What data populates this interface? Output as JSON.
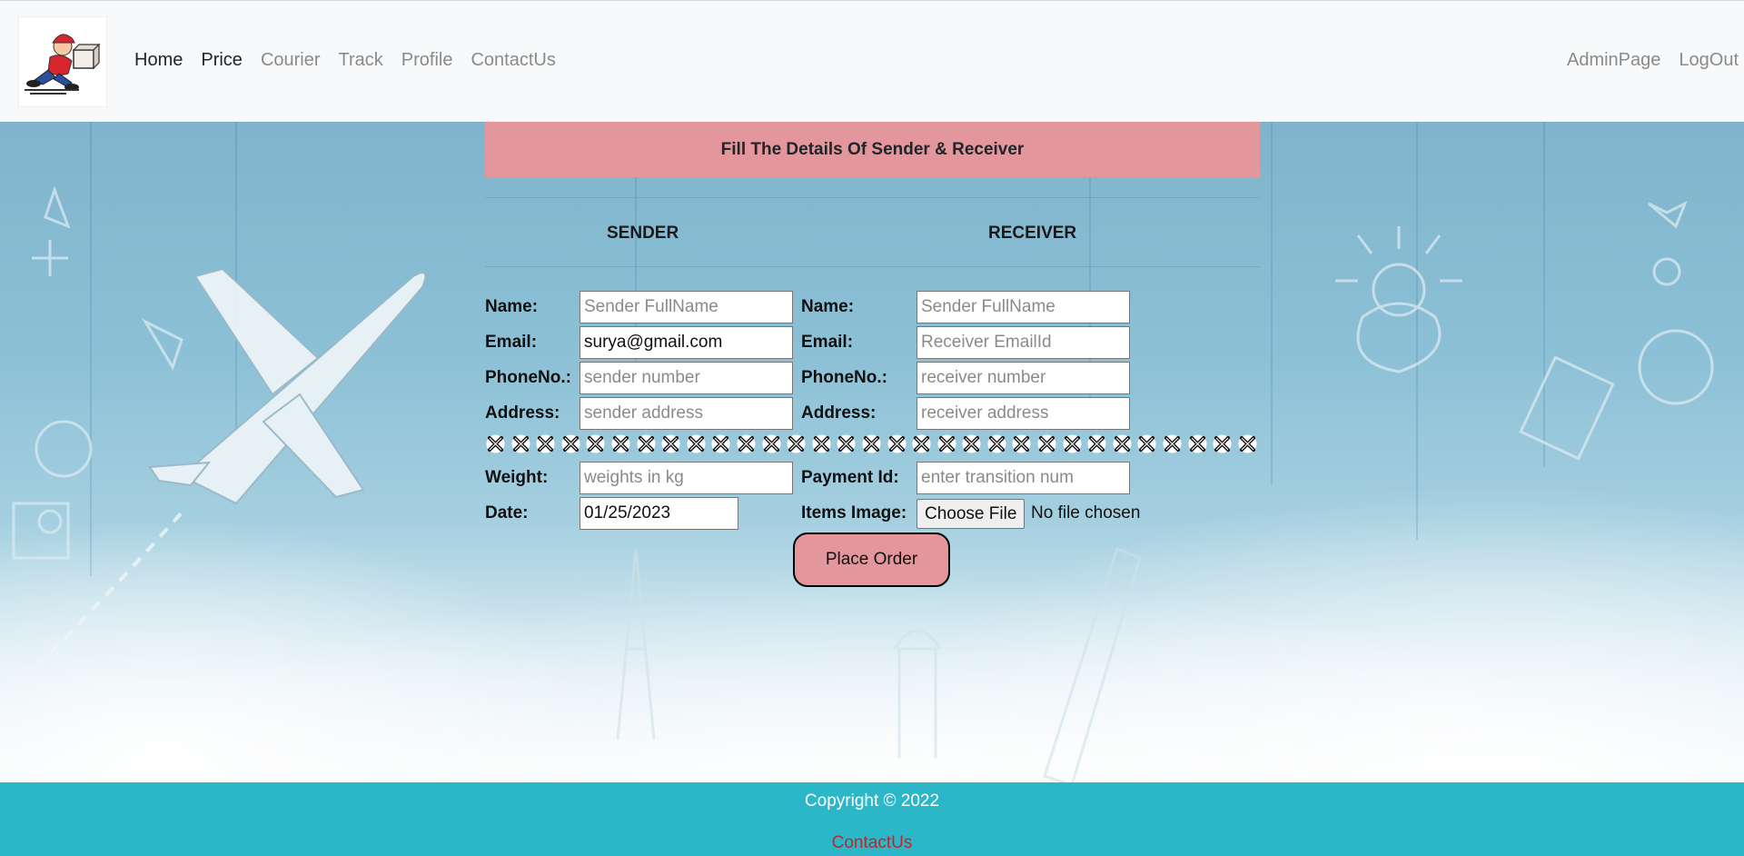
{
  "nav": {
    "left": [
      "Home",
      "Price",
      "Courier",
      "Track",
      "Profile",
      "ContactUs"
    ],
    "right": [
      "AdminPage",
      "LogOut"
    ]
  },
  "form": {
    "banner": "Fill The Details Of Sender & Receiver",
    "sender_heading": "SENDER",
    "receiver_heading": "RECEIVER",
    "sender": {
      "name_label": "Name:",
      "name_placeholder": "Sender FullName",
      "name_value": "",
      "email_label": "Email:",
      "email_placeholder": "",
      "email_value": "surya@gmail.com",
      "phone_label": "PhoneNo.:",
      "phone_placeholder": "sender number",
      "address_label": "Address:",
      "address_placeholder": "sender address"
    },
    "receiver": {
      "name_label": "Name:",
      "name_placeholder": "Sender FullName",
      "email_label": "Email:",
      "email_placeholder": "Receiver EmailId",
      "phone_label": "PhoneNo.:",
      "phone_placeholder": "receiver number",
      "address_label": "Address:",
      "address_placeholder": "receiver address"
    },
    "weight_label": "Weight:",
    "weight_placeholder": "weights in kg",
    "date_label": "Date:",
    "date_value": "01/25/2023",
    "payment_label": "Payment Id:",
    "payment_placeholder": "enter transition num",
    "items_label": "Items Image:",
    "file_button": "Choose File",
    "file_status": "No file chosen",
    "submit": "Place Order",
    "separator_count": 31
  },
  "footer": {
    "copyright": "Copyright © 2022",
    "link": "ContactUs"
  },
  "colors": {
    "banner": "#e3979c",
    "footer": "#2bb7c8",
    "footer_link": "#b52a2a",
    "navbar": "#f8f9fa"
  }
}
